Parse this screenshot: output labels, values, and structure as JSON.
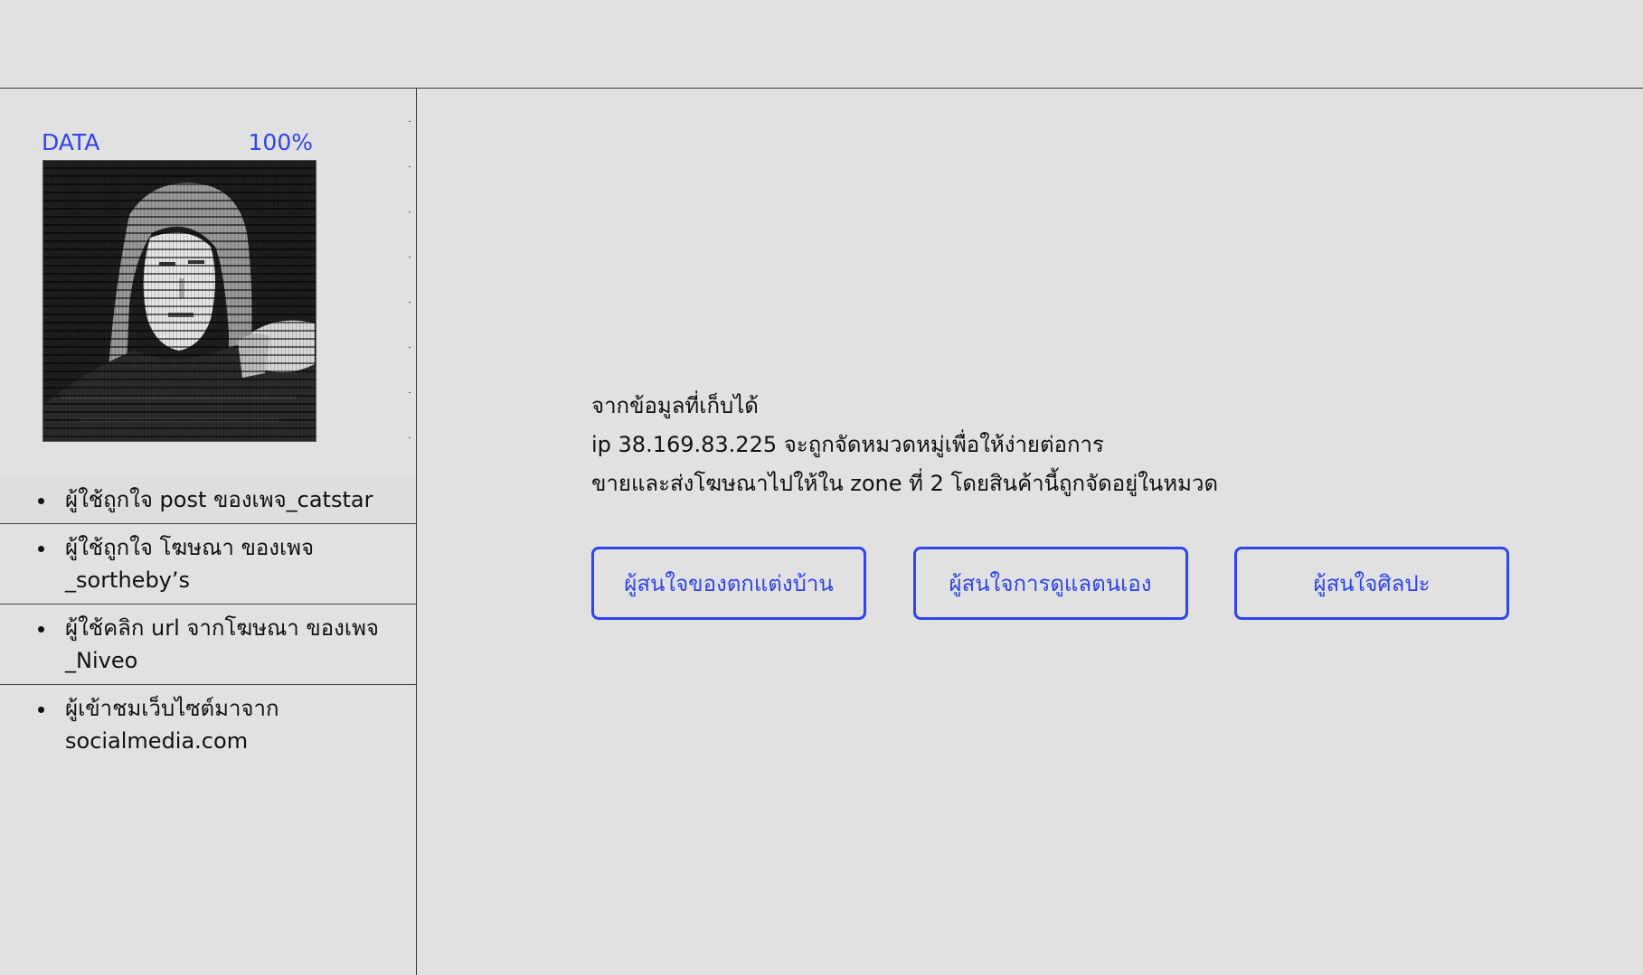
{
  "sidebar": {
    "data_label": "DATA",
    "data_progress": "100%",
    "portrait_icon": "person-portrait-image",
    "items": [
      {
        "lines": [
          "ผู้ใช้ถูกใจ post ของเพจ_catstar"
        ]
      },
      {
        "lines": [
          "ผู้ใช้ถูกใจ โฆษณา ของเพจ",
          "_sortheby’s"
        ]
      },
      {
        "lines": [
          "ผู้ใช้คลิก url จากโฆษณา ของเพจ",
          "_Niveo"
        ]
      },
      {
        "lines": [
          "ผู้เข้าชมเว็บไซต์มาจาก",
          " socialmedia.com"
        ]
      }
    ]
  },
  "main": {
    "message_lines": [
      "จากข้อมูลที่เก็บได้",
      " ip 38.169.83.225 จะถูกจัดหมวดหมู่เพื่อให้ง่ายต่อการ",
      "ขายและส่งโฆษณาไปให้ใน zone ที่ 2 โดยสินค้านี้ถูกจัดอยู่ในหมวด"
    ],
    "buttons": [
      {
        "label": "ผู้สนใจของตกแต่งบ้าน"
      },
      {
        "label": "ผู้สนใจการดูแลตนเอง"
      },
      {
        "label": "ผู้สนใจศิลปะ"
      }
    ]
  },
  "colors": {
    "accent": "#2f45ee",
    "background": "#e1e1e1",
    "divider": "#333333"
  }
}
